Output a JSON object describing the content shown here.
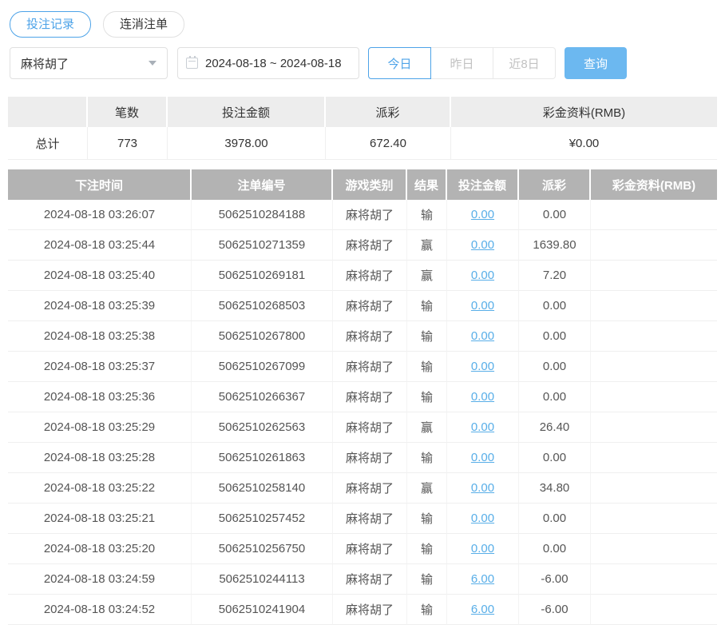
{
  "colors": {
    "accent": "#4da3e8",
    "search_button": "#6cb8f0",
    "link": "#58aee8",
    "negative": "#f0504f",
    "table_header_bg": "#b3b3b3",
    "summary_header_bg": "#ededed"
  },
  "tabs": [
    {
      "label": "投注记录",
      "active": true
    },
    {
      "label": "连消注单",
      "active": false
    }
  ],
  "filters": {
    "game_select": {
      "value": "麻将胡了"
    },
    "date_range": "2024-08-18 ~ 2024-08-18",
    "quick_buttons": [
      {
        "label": "今日",
        "active": true
      },
      {
        "label": "昨日",
        "active": false
      },
      {
        "label": "近8日",
        "active": false
      }
    ],
    "search_label": "查询"
  },
  "summary": {
    "headers": [
      "",
      "笔数",
      "投注金额",
      "派彩",
      "彩金资料(RMB)"
    ],
    "total": {
      "label": "总计",
      "count": "773",
      "bet_amount": "3978.00",
      "payout": "672.40",
      "jackpot": "¥0.00"
    }
  },
  "table": {
    "headers": [
      "下注时间",
      "注单编号",
      "游戏类别",
      "结果",
      "投注金额",
      "派彩",
      "彩金资料(RMB)"
    ],
    "rows": [
      {
        "time": "2024-08-18 03:26:07",
        "order": "5062510284188",
        "game": "麻将胡了",
        "result": "输",
        "bet": "0.00",
        "payout": "0.00",
        "payout_negative": false,
        "jackpot": ""
      },
      {
        "time": "2024-08-18 03:25:44",
        "order": "5062510271359",
        "game": "麻将胡了",
        "result": "赢",
        "bet": "0.00",
        "payout": "1639.80",
        "payout_negative": false,
        "jackpot": ""
      },
      {
        "time": "2024-08-18 03:25:40",
        "order": "5062510269181",
        "game": "麻将胡了",
        "result": "赢",
        "bet": "0.00",
        "payout": "7.20",
        "payout_negative": false,
        "jackpot": ""
      },
      {
        "time": "2024-08-18 03:25:39",
        "order": "5062510268503",
        "game": "麻将胡了",
        "result": "输",
        "bet": "0.00",
        "payout": "0.00",
        "payout_negative": false,
        "jackpot": ""
      },
      {
        "time": "2024-08-18 03:25:38",
        "order": "5062510267800",
        "game": "麻将胡了",
        "result": "输",
        "bet": "0.00",
        "payout": "0.00",
        "payout_negative": false,
        "jackpot": ""
      },
      {
        "time": "2024-08-18 03:25:37",
        "order": "5062510267099",
        "game": "麻将胡了",
        "result": "输",
        "bet": "0.00",
        "payout": "0.00",
        "payout_negative": false,
        "jackpot": ""
      },
      {
        "time": "2024-08-18 03:25:36",
        "order": "5062510266367",
        "game": "麻将胡了",
        "result": "输",
        "bet": "0.00",
        "payout": "0.00",
        "payout_negative": false,
        "jackpot": ""
      },
      {
        "time": "2024-08-18 03:25:29",
        "order": "5062510262563",
        "game": "麻将胡了",
        "result": "赢",
        "bet": "0.00",
        "payout": "26.40",
        "payout_negative": false,
        "jackpot": ""
      },
      {
        "time": "2024-08-18 03:25:28",
        "order": "5062510261863",
        "game": "麻将胡了",
        "result": "输",
        "bet": "0.00",
        "payout": "0.00",
        "payout_negative": false,
        "jackpot": ""
      },
      {
        "time": "2024-08-18 03:25:22",
        "order": "5062510258140",
        "game": "麻将胡了",
        "result": "赢",
        "bet": "0.00",
        "payout": "34.80",
        "payout_negative": false,
        "jackpot": ""
      },
      {
        "time": "2024-08-18 03:25:21",
        "order": "5062510257452",
        "game": "麻将胡了",
        "result": "输",
        "bet": "0.00",
        "payout": "0.00",
        "payout_negative": false,
        "jackpot": ""
      },
      {
        "time": "2024-08-18 03:25:20",
        "order": "5062510256750",
        "game": "麻将胡了",
        "result": "输",
        "bet": "0.00",
        "payout": "0.00",
        "payout_negative": false,
        "jackpot": ""
      },
      {
        "time": "2024-08-18 03:24:59",
        "order": "5062510244113",
        "game": "麻将胡了",
        "result": "输",
        "bet": "6.00",
        "payout": "-6.00",
        "payout_negative": true,
        "jackpot": ""
      },
      {
        "time": "2024-08-18 03:24:52",
        "order": "5062510241904",
        "game": "麻将胡了",
        "result": "输",
        "bet": "6.00",
        "payout": "-6.00",
        "payout_negative": true,
        "jackpot": ""
      }
    ]
  }
}
